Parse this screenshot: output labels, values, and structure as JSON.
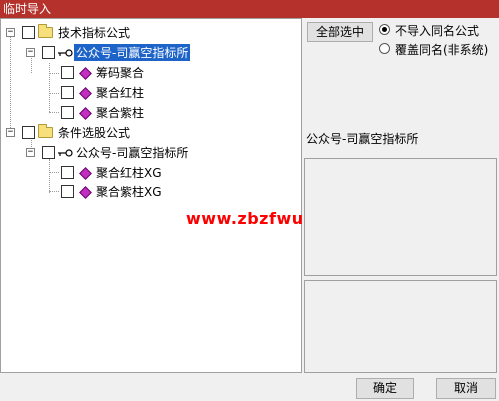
{
  "window": {
    "title": "临时导入"
  },
  "tree": {
    "groups": [
      {
        "label": "技术指标公式",
        "child": {
          "label": "公众号-司赢空指标所",
          "items": [
            "筹码聚合",
            "聚合红柱",
            "聚合紫柱"
          ]
        }
      },
      {
        "label": "条件选股公式",
        "child": {
          "label": "公众号-司赢空指标所",
          "items": [
            "聚合红柱XG",
            "聚合紫柱XG"
          ]
        }
      }
    ]
  },
  "watermark": "www.zbzfwu.com",
  "right_panel": {
    "select_all": "全部选中",
    "options": [
      "不导入同名公式",
      "覆盖同名(非系统)"
    ],
    "selected_option": 0,
    "info_label": "公众号-司赢空指标所"
  },
  "footer": {
    "ok": "确定",
    "cancel": "取消"
  }
}
